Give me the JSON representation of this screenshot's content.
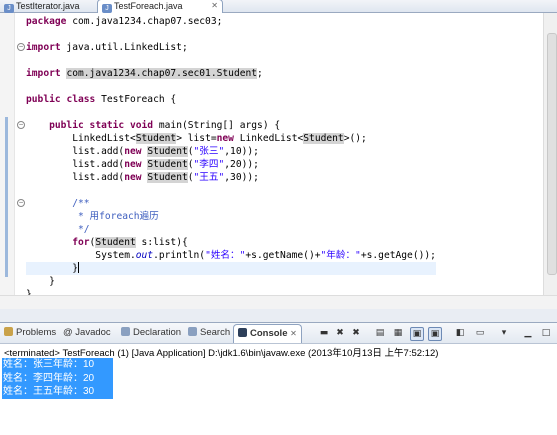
{
  "editor_tabs": [
    {
      "label": "TestIterator.java",
      "active": false
    },
    {
      "label": "TestForeach.java",
      "active": true
    }
  ],
  "code_lines": [
    {
      "tokens": [
        {
          "t": "kw",
          "v": "package"
        },
        {
          "t": "",
          "v": " com.java1234.chap07.sec03;"
        }
      ]
    },
    {
      "tokens": []
    },
    {
      "tokens": [
        {
          "t": "kw",
          "v": "import"
        },
        {
          "t": "",
          "v": " java.util.LinkedList;"
        }
      ]
    },
    {
      "tokens": []
    },
    {
      "tokens": [
        {
          "t": "kw",
          "v": "import"
        },
        {
          "t": "",
          "v": " "
        },
        {
          "t": "hl",
          "v": "com.java1234.chap07.sec01.Student"
        },
        {
          "t": "",
          "v": ";"
        }
      ]
    },
    {
      "tokens": []
    },
    {
      "tokens": [
        {
          "t": "kw",
          "v": "public"
        },
        {
          "t": "",
          "v": " "
        },
        {
          "t": "kw",
          "v": "class"
        },
        {
          "t": "",
          "v": " TestForeach {"
        }
      ]
    },
    {
      "tokens": []
    },
    {
      "tokens": [
        {
          "t": "",
          "v": "    "
        },
        {
          "t": "kw",
          "v": "public"
        },
        {
          "t": "",
          "v": " "
        },
        {
          "t": "kw",
          "v": "static"
        },
        {
          "t": "",
          "v": " "
        },
        {
          "t": "kw",
          "v": "void"
        },
        {
          "t": "",
          "v": " main(String[] args) {"
        }
      ]
    },
    {
      "tokens": [
        {
          "t": "",
          "v": "        LinkedList<"
        },
        {
          "t": "hl",
          "v": "Student"
        },
        {
          "t": "",
          "v": "> list="
        },
        {
          "t": "kw",
          "v": "new"
        },
        {
          "t": "",
          "v": " LinkedList<"
        },
        {
          "t": "hl",
          "v": "Student"
        },
        {
          "t": "",
          "v": ">();"
        }
      ]
    },
    {
      "tokens": [
        {
          "t": "",
          "v": "        list.add("
        },
        {
          "t": "kw",
          "v": "new"
        },
        {
          "t": "",
          "v": " "
        },
        {
          "t": "hl",
          "v": "Student"
        },
        {
          "t": "",
          "v": "("
        },
        {
          "t": "st",
          "v": "\"张三\""
        },
        {
          "t": "",
          "v": ",10));"
        }
      ]
    },
    {
      "tokens": [
        {
          "t": "",
          "v": "        list.add("
        },
        {
          "t": "kw",
          "v": "new"
        },
        {
          "t": "",
          "v": " "
        },
        {
          "t": "hl",
          "v": "Student"
        },
        {
          "t": "",
          "v": "("
        },
        {
          "t": "st",
          "v": "\"李四\""
        },
        {
          "t": "",
          "v": ",20));"
        }
      ]
    },
    {
      "tokens": [
        {
          "t": "",
          "v": "        list.add("
        },
        {
          "t": "kw",
          "v": "new"
        },
        {
          "t": "",
          "v": " "
        },
        {
          "t": "hl",
          "v": "Student"
        },
        {
          "t": "",
          "v": "("
        },
        {
          "t": "st",
          "v": "\"王五\""
        },
        {
          "t": "",
          "v": ",30));"
        }
      ]
    },
    {
      "tokens": []
    },
    {
      "tokens": [
        {
          "t": "cm",
          "v": "        /**"
        }
      ]
    },
    {
      "tokens": [
        {
          "t": "cm",
          "v": "         * 用foreach遍历"
        }
      ]
    },
    {
      "tokens": [
        {
          "t": "cm",
          "v": "         */"
        }
      ]
    },
    {
      "tokens": [
        {
          "t": "",
          "v": "        "
        },
        {
          "t": "kw",
          "v": "for"
        },
        {
          "t": "",
          "v": "("
        },
        {
          "t": "hl",
          "v": "Student"
        },
        {
          "t": "",
          "v": " s:list){"
        }
      ]
    },
    {
      "tokens": [
        {
          "t": "",
          "v": "            System."
        },
        {
          "t": "fld",
          "v": "out"
        },
        {
          "t": "",
          "v": ".println("
        },
        {
          "t": "st",
          "v": "\"姓名：\""
        },
        {
          "t": "",
          "v": "+s.getName()+"
        },
        {
          "t": "st",
          "v": "\"年龄：\""
        },
        {
          "t": "",
          "v": "+s.getAge());"
        }
      ]
    },
    {
      "tokens": [
        {
          "t": "",
          "v": "        }"
        }
      ],
      "current": true
    },
    {
      "tokens": [
        {
          "t": "",
          "v": "    }"
        }
      ]
    },
    {
      "tokens": [
        {
          "t": "",
          "v": "}"
        }
      ]
    }
  ],
  "panel_tabs": [
    {
      "label": "Problems",
      "icon": "problems-icon",
      "color": "#c9a24a"
    },
    {
      "label": "@ Javadoc",
      "icon": "",
      "color": ""
    },
    {
      "label": "Declaration",
      "icon": "declaration-icon",
      "color": "#8aa0c0"
    },
    {
      "label": "Search",
      "icon": "search-icon",
      "color": "#8aa0c0"
    },
    {
      "label": "Console",
      "icon": "console-icon",
      "color": "#2d3f5a",
      "active": true
    }
  ],
  "console": {
    "status": "<terminated> TestForeach (1) [Java Application] D:\\jdk1.6\\bin\\javaw.exe (2013年10月13日 上午7:52:12)",
    "output": [
      "姓名：张三年龄：10",
      "姓名：李四年龄：20",
      "姓名：王五年龄：30"
    ]
  },
  "colors": {
    "keyword": "#7f0055",
    "string": "#2a00ff",
    "comment": "#3f5fbf",
    "selection": "#3399ff"
  }
}
